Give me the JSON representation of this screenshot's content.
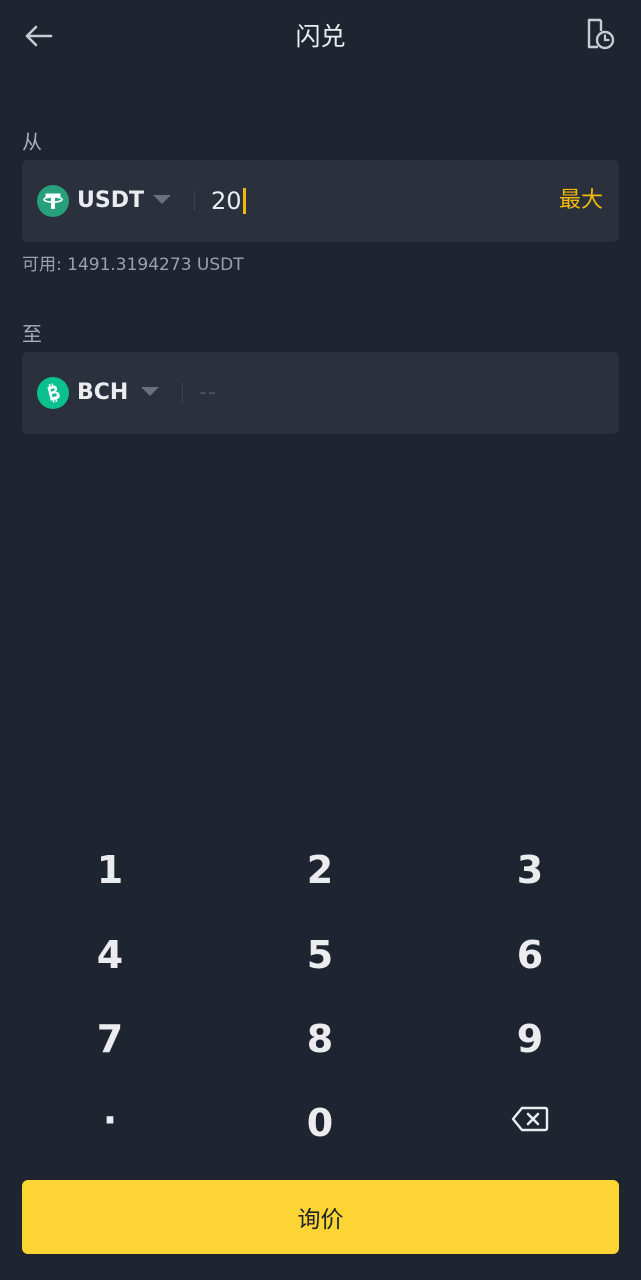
{
  "header": {
    "title": "闪兑"
  },
  "from": {
    "label": "从",
    "coin": "USDT",
    "amount": "20",
    "max_label": "最大",
    "available": "可用: 1491.3194273 USDT"
  },
  "to": {
    "label": "至",
    "coin": "BCH",
    "placeholder": "--"
  },
  "keypad": {
    "keys": [
      "1",
      "2",
      "3",
      "4",
      "5",
      "6",
      "7",
      "8",
      "9",
      "·",
      "0"
    ],
    "backspace_icon": "backspace-icon"
  },
  "submit": {
    "label": "询价"
  },
  "colors": {
    "background": "#1f2530",
    "card": "#2a303c",
    "accent": "#f0b90b",
    "button": "#fcd535",
    "usdt": "#26a17b",
    "bch": "#0ac18e"
  },
  "icons": {
    "back": "arrow-left-icon",
    "history": "history-clock-icon",
    "usdt": "tether-icon",
    "bch": "bitcoin-cash-icon"
  }
}
